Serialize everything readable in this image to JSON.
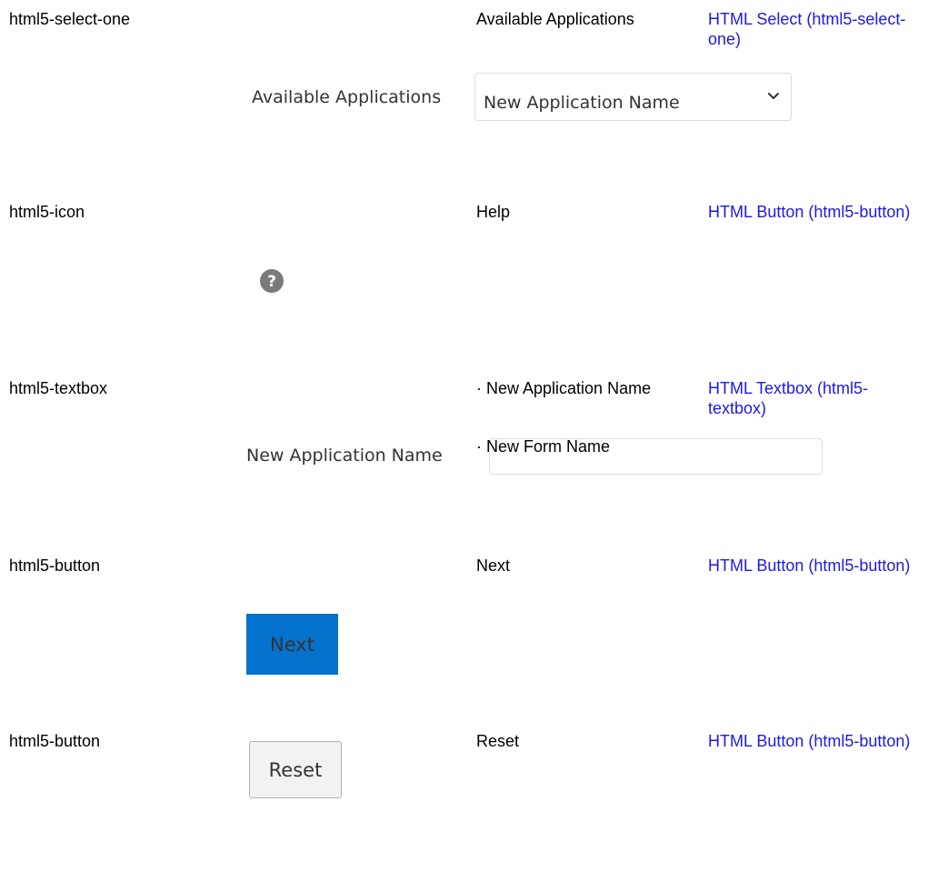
{
  "rows": [
    {
      "type": "html5-select-one",
      "label": "Available Applications",
      "link": "HTML Select (html5-select-one)"
    },
    {
      "type": "html5-icon",
      "label": "Help",
      "link": "HTML Button (html5-button)"
    },
    {
      "type": "html5-textbox",
      "label_items": [
        "· New Application Name",
        "· New Form Name"
      ],
      "link": "HTML Textbox (html5-textbox)"
    },
    {
      "type": "html5-button",
      "label": "Next",
      "link": "HTML Button (html5-button)"
    },
    {
      "type": "html5-button",
      "label": "Reset",
      "link": "HTML Button (html5-button)"
    }
  ],
  "screenshots": {
    "select": {
      "label": "Available Applications",
      "value": "New Application Name",
      "icon": "chevron-down-icon"
    },
    "help": {
      "icon": "question-circle-icon",
      "color": "#7a7a7a"
    },
    "textbox": {
      "label": "New Application Name",
      "value": ""
    },
    "next_button": {
      "label": "Next",
      "color": "#0572ce"
    },
    "reset_button": {
      "label": "Reset",
      "color": "#f2f2f2"
    }
  },
  "colors": {
    "link": "#1a1ae6",
    "text": "#000000"
  }
}
